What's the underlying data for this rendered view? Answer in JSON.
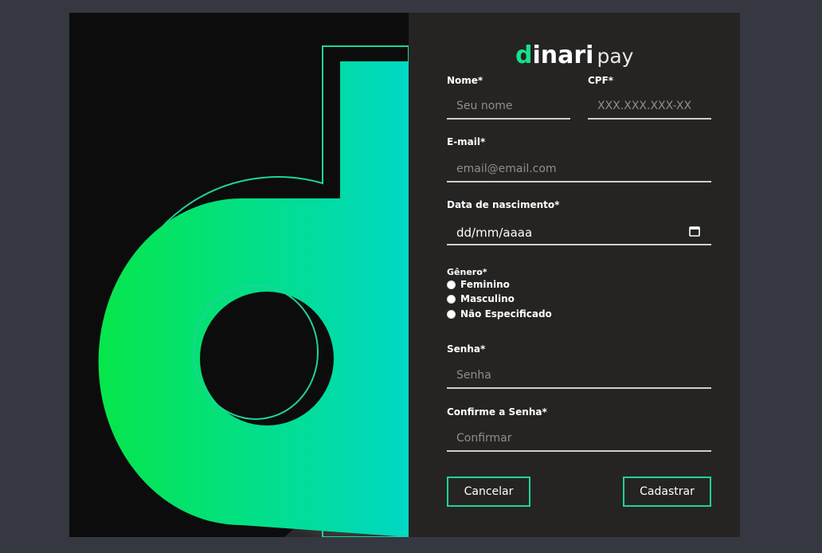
{
  "logo": {
    "brand_first": "d",
    "brand_rest": "inari",
    "brand_sub": "pay"
  },
  "form": {
    "nome": {
      "label": "Nome*",
      "placeholder": "Seu nome"
    },
    "cpf": {
      "label": "CPF*",
      "placeholder": "XXX.XXX.XXX-XX"
    },
    "email": {
      "label": "E-mail*",
      "placeholder": "email@email.com"
    },
    "nascimento": {
      "label": "Data de nascimento*",
      "value": "dd/mm/aaaa",
      "icon": "calendar-icon"
    },
    "genero": {
      "label": "Gênero*",
      "options": [
        "Feminino",
        "Masculino",
        "Não Especificado"
      ]
    },
    "senha": {
      "label": "Senha*",
      "placeholder": "Senha"
    },
    "confirmar": {
      "label": "Confirme a Senha*",
      "placeholder": "Confirmar"
    }
  },
  "buttons": {
    "cancel": "Cancelar",
    "submit": "Cadastrar"
  },
  "colors": {
    "accent": "#1ed49a",
    "gradient_start": "#06e64a",
    "gradient_end": "#00d8c4",
    "panel_bg": "#252423",
    "page_bg": "#353840"
  }
}
